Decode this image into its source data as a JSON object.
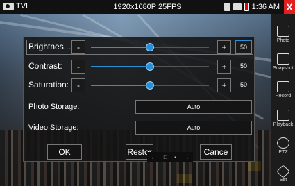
{
  "status_bar": {
    "mode": "TVI",
    "resolution": "1920x1080P 25FPS",
    "time": "1:36 AM",
    "close_label": "X",
    "battery_color": "#e00000"
  },
  "dialog": {
    "sliders": [
      {
        "label": "Brightnes...",
        "minus": "-",
        "plus": "+",
        "value": "50",
        "level": 0.5
      },
      {
        "label": "Contrast:",
        "minus": "-",
        "plus": "+",
        "value": "50",
        "level": 0.5
      },
      {
        "label": "Saturation:",
        "minus": "-",
        "plus": "+",
        "value": "50",
        "level": 0.5
      }
    ],
    "photo_storage": {
      "label": "Photo Storage:",
      "value": "Auto"
    },
    "video_storage": {
      "label": "Video Storage:",
      "value": "Auto"
    },
    "ok_label": "OK",
    "restore_label": "Restor",
    "cancel_label": "Cance"
  },
  "sidebar": {
    "items": [
      {
        "label": "Photo",
        "icon": "photo-icon"
      },
      {
        "label": "Snapshot",
        "icon": "snapshot-icon"
      },
      {
        "label": "Record",
        "icon": "record-icon"
      },
      {
        "label": "Playback",
        "icon": "playback-icon"
      },
      {
        "label": "PTZ",
        "icon": "ptz-icon"
      },
      {
        "label": "Set",
        "icon": "settings-icon"
      }
    ]
  },
  "mini_bar": {
    "items": [
      "←",
      "□",
      "▪",
      "→"
    ]
  },
  "colors": {
    "accent": "#2b8fd8",
    "close": "#e02020"
  }
}
